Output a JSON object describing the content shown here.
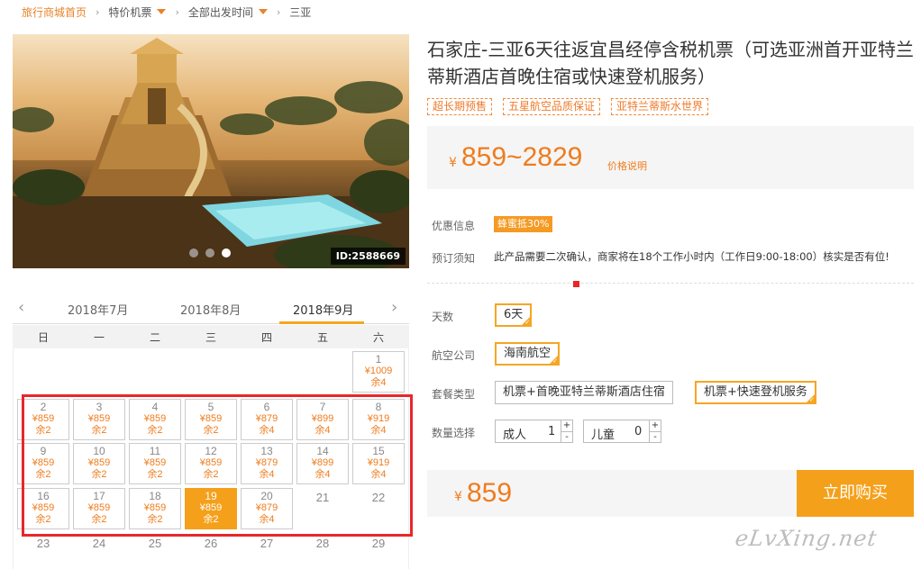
{
  "breadcrumb": {
    "home": "旅行商城首页",
    "category": "特价机票",
    "departure": "全部出发时间",
    "destination": "三亚",
    "separator": "›"
  },
  "hero": {
    "image_id": "ID:2588669",
    "description_icon": "resort-water-park-image"
  },
  "calendar": {
    "months": [
      "2018年7月",
      "2018年8月",
      "2018年9月"
    ],
    "active_month": "2018年9月",
    "weekdays": [
      "日",
      "一",
      "二",
      "三",
      "四",
      "五",
      "六"
    ],
    "days_with_price": [
      {
        "day": "1",
        "price": "¥1009",
        "remain": "余4"
      },
      {
        "day": "2",
        "price": "¥859",
        "remain": "余2"
      },
      {
        "day": "3",
        "price": "¥859",
        "remain": "余2"
      },
      {
        "day": "4",
        "price": "¥859",
        "remain": "余2"
      },
      {
        "day": "5",
        "price": "¥859",
        "remain": "余2"
      },
      {
        "day": "6",
        "price": "¥879",
        "remain": "余4"
      },
      {
        "day": "7",
        "price": "¥899",
        "remain": "余4"
      },
      {
        "day": "8",
        "price": "¥919",
        "remain": "余4"
      },
      {
        "day": "9",
        "price": "¥859",
        "remain": "余2"
      },
      {
        "day": "10",
        "price": "¥859",
        "remain": "余2"
      },
      {
        "day": "11",
        "price": "¥859",
        "remain": "余2"
      },
      {
        "day": "12",
        "price": "¥859",
        "remain": "余2"
      },
      {
        "day": "13",
        "price": "¥879",
        "remain": "余4"
      },
      {
        "day": "14",
        "price": "¥899",
        "remain": "余4"
      },
      {
        "day": "15",
        "price": "¥919",
        "remain": "余4"
      },
      {
        "day": "16",
        "price": "¥859",
        "remain": "余2"
      },
      {
        "day": "17",
        "price": "¥859",
        "remain": "余2"
      },
      {
        "day": "18",
        "price": "¥859",
        "remain": "余2"
      },
      {
        "day": "19",
        "price": "¥859",
        "remain": "余2"
      },
      {
        "day": "20",
        "price": "¥879",
        "remain": "余4"
      }
    ],
    "selected_day": "19",
    "plain_days": [
      "21",
      "22",
      "23",
      "24",
      "25",
      "26",
      "27",
      "28",
      "29"
    ]
  },
  "product": {
    "title": "石家庄-三亚6天往返宜昌经停含税机票（可选亚洲首开亚特兰蒂斯酒店首晚住宿或快速登机服务）",
    "tags": [
      "超长期预售",
      "五星航空品质保证",
      "亚特兰蒂斯水世界"
    ],
    "price_currency": "¥",
    "price_range": "859~2829",
    "price_note": "价格说明",
    "promo_label": "优惠信息",
    "promo_badge": "蜂蜜抵30%",
    "notice_label": "预订须知",
    "notice_text": "此产品需要二次确认，商家将在18个工作小时内（工作日9:00-18:00）核实是否有位!"
  },
  "options": {
    "days_label": "天数",
    "days_value": "6天",
    "airline_label": "航空公司",
    "airline_value": "海南航空",
    "package_label": "套餐类型",
    "package_options": [
      "机票+首晚亚特兰蒂斯酒店住宿",
      "机票+快速登机服务"
    ],
    "package_selected": "机票+快速登机服务",
    "qty_label": "数量选择",
    "adult_label": "成人",
    "adult_value": "1",
    "child_label": "儿童",
    "child_value": "0",
    "plus": "+",
    "minus": "-"
  },
  "purchase": {
    "currency": "¥",
    "price": "859",
    "buy_label": "立即购买"
  },
  "watermark": "eLvXing.net",
  "colors": {
    "accent_orange": "#f5a01a",
    "price_orange": "#ef7c1d",
    "highlight_red": "#e8272b"
  }
}
